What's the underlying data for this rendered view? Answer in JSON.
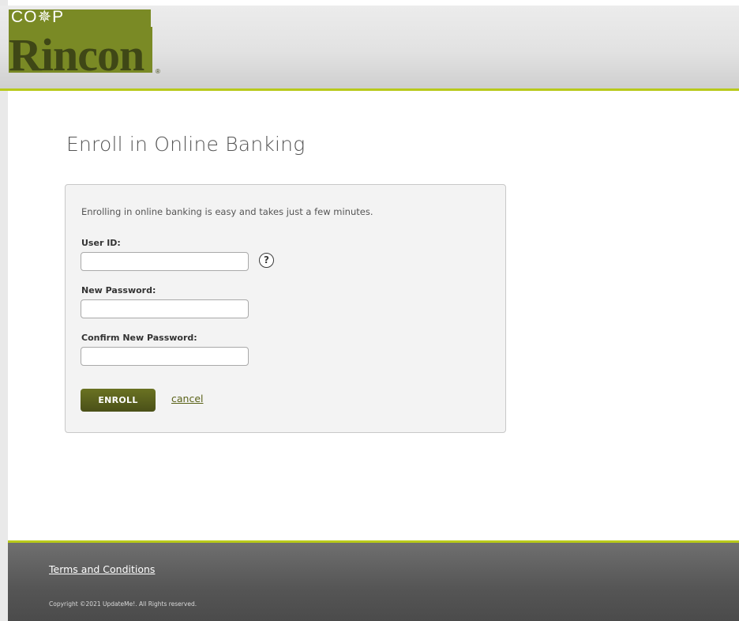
{
  "header": {
    "logo": {
      "top_text": "CO✵P",
      "brand_text": "Rincon",
      "registered_mark": "®"
    }
  },
  "main": {
    "title": "Enroll in Online Banking",
    "intro": "Enrolling in online banking is easy and takes just a few minutes.",
    "fields": {
      "user_id": {
        "label": "User ID:",
        "value": "",
        "placeholder": ""
      },
      "new_password": {
        "label": "New Password:",
        "value": "",
        "placeholder": ""
      },
      "confirm_password": {
        "label": "Confirm New Password:",
        "value": "",
        "placeholder": ""
      }
    },
    "help_icon": {
      "icon": "question-circle-icon",
      "glyph": "?"
    },
    "enroll_label": "ENROLL",
    "cancel_label": "cancel"
  },
  "footer": {
    "terms_label": "Terms and Conditions",
    "copyright": "Copyright ©2021 UpdateMe!. All Rights reserved."
  },
  "colors": {
    "accent_lime": "#b8c91a",
    "brand_olive": "#7a8a25",
    "button_dark_olive": "#4a5018",
    "footer_gray": "#555555"
  }
}
